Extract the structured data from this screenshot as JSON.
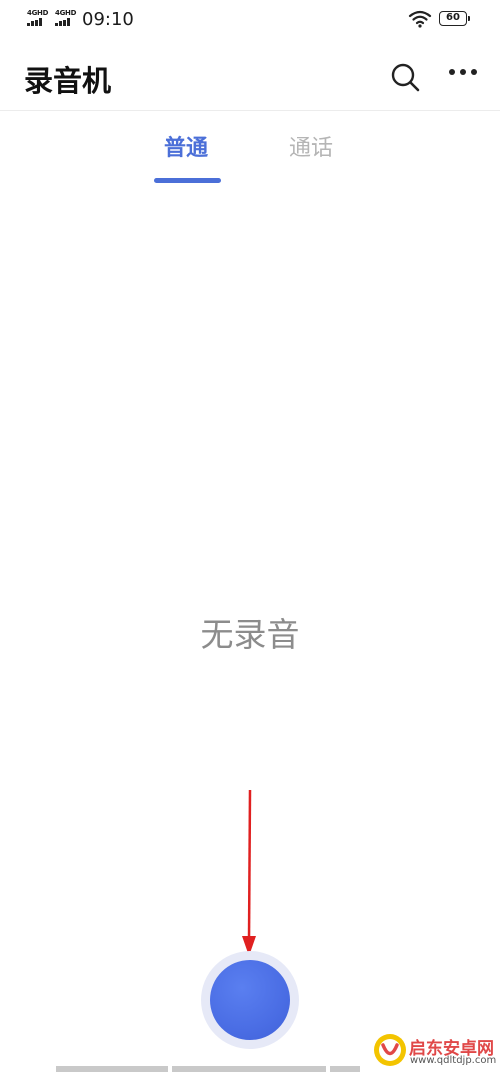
{
  "status_bar": {
    "network1": "4GHD",
    "network2": "4GHD",
    "time": "09:10",
    "battery": "60",
    "icons": [
      "signal-icon",
      "wifi-icon",
      "battery-icon"
    ]
  },
  "header": {
    "title": "录音机",
    "icons": [
      "search-icon",
      "more-icon"
    ]
  },
  "tabs": [
    {
      "label": "普通",
      "active": true
    },
    {
      "label": "通话",
      "active": false
    }
  ],
  "main": {
    "empty_text": "无录音"
  },
  "record_button": {
    "icon": "record-icon"
  },
  "watermark": {
    "name": "启东安卓网",
    "url": "www.qdltdjp.com"
  },
  "colors": {
    "accent": "#4b6fd8",
    "inactive_tab": "#b5b5b5",
    "empty_text": "#8c8c8c",
    "record_ring": "#e6e9f7",
    "annotation_arrow": "#e02020"
  }
}
